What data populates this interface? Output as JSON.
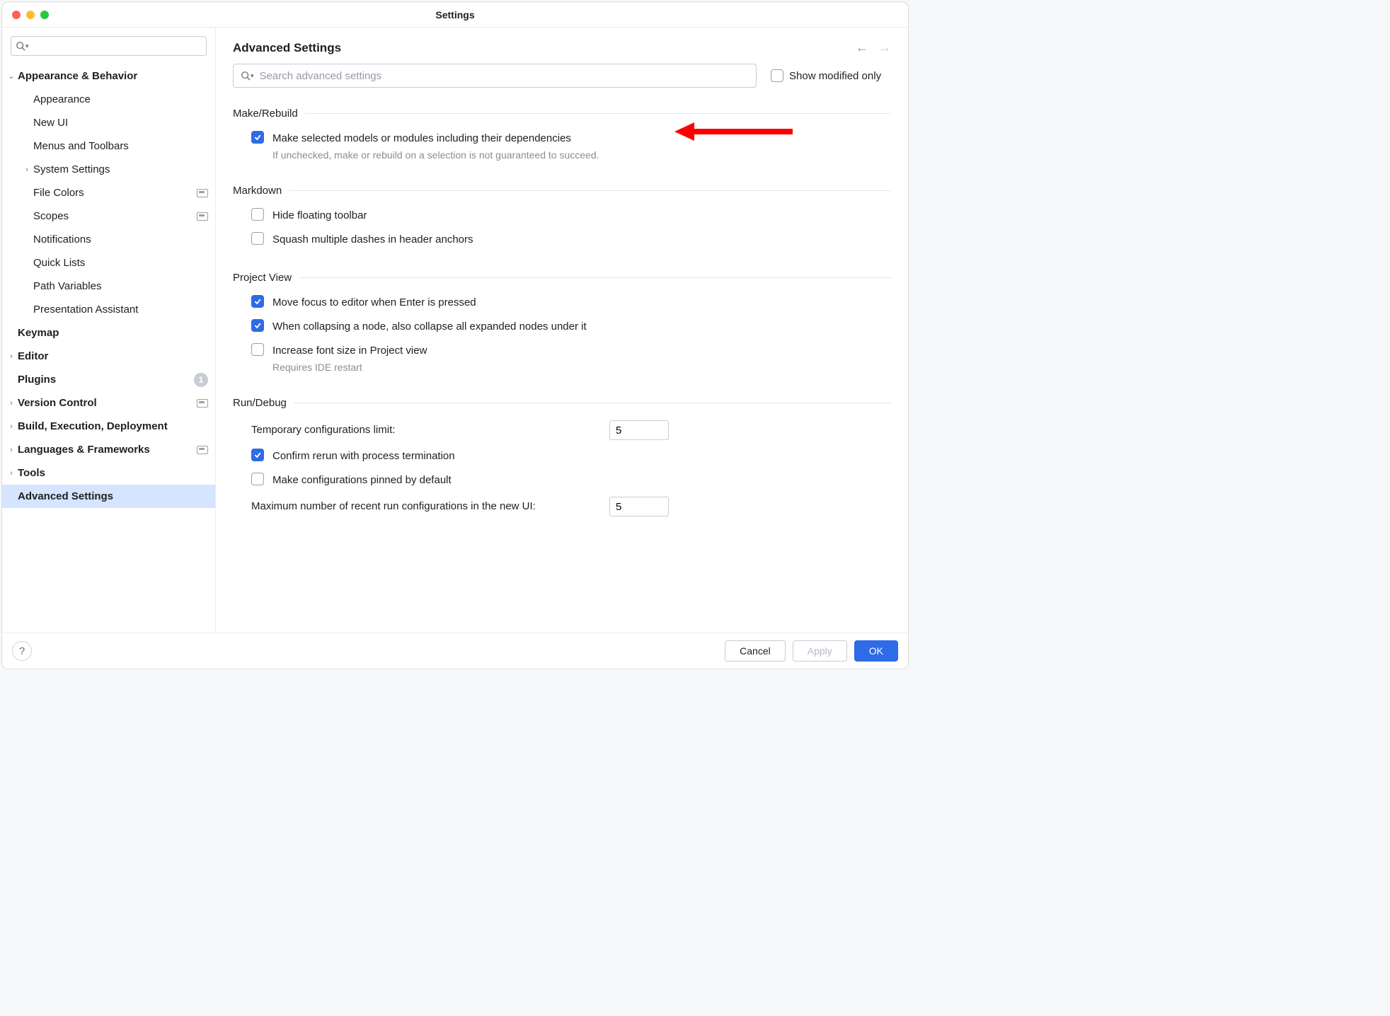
{
  "window": {
    "title": "Settings"
  },
  "sidebar": {
    "search_value": "",
    "items": [
      {
        "label": "Appearance & Behavior",
        "bold": true,
        "arrow": "down",
        "indent": 1
      },
      {
        "label": "Appearance",
        "indent": 2
      },
      {
        "label": "New UI",
        "indent": 2
      },
      {
        "label": "Menus and Toolbars",
        "indent": 2
      },
      {
        "label": "System Settings",
        "indent": 2,
        "arrow": "right"
      },
      {
        "label": "File Colors",
        "indent": 2,
        "tag": true
      },
      {
        "label": "Scopes",
        "indent": 2,
        "tag": true
      },
      {
        "label": "Notifications",
        "indent": 2
      },
      {
        "label": "Quick Lists",
        "indent": 2
      },
      {
        "label": "Path Variables",
        "indent": 2
      },
      {
        "label": "Presentation Assistant",
        "indent": 2
      },
      {
        "label": "Keymap",
        "bold": true,
        "indent": 1
      },
      {
        "label": "Editor",
        "bold": true,
        "arrow": "right",
        "indent": 1
      },
      {
        "label": "Plugins",
        "bold": true,
        "indent": 1,
        "count": "1"
      },
      {
        "label": "Version Control",
        "bold": true,
        "arrow": "right",
        "indent": 1,
        "tag": true
      },
      {
        "label": "Build, Execution, Deployment",
        "bold": true,
        "arrow": "right",
        "indent": 1
      },
      {
        "label": "Languages & Frameworks",
        "bold": true,
        "arrow": "right",
        "indent": 1,
        "tag": true
      },
      {
        "label": "Tools",
        "bold": true,
        "arrow": "right",
        "indent": 1
      },
      {
        "label": "Advanced Settings",
        "bold": true,
        "indent": 1,
        "selected": true
      }
    ]
  },
  "main": {
    "title": "Advanced Settings",
    "search_placeholder": "Search advanced settings",
    "show_modified_only": {
      "label": "Show modified only",
      "checked": false
    },
    "sections": {
      "make_rebuild": {
        "title": "Make/Rebuild",
        "opt1": {
          "label": "Make selected models or modules including their dependencies",
          "desc": "If unchecked, make or rebuild on a selection is not guaranteed to succeed.",
          "checked": true
        }
      },
      "markdown": {
        "title": "Markdown",
        "opt1": {
          "label": "Hide floating toolbar",
          "checked": false
        },
        "opt2": {
          "label": "Squash multiple dashes in header anchors",
          "checked": false
        }
      },
      "project_view": {
        "title": "Project View",
        "opt1": {
          "label": "Move focus to editor when Enter is pressed",
          "checked": true
        },
        "opt2": {
          "label": "When collapsing a node, also collapse all expanded nodes under it",
          "checked": true
        },
        "opt3": {
          "label": "Increase font size in Project view",
          "desc": "Requires IDE restart",
          "checked": false
        }
      },
      "run_debug": {
        "title": "Run/Debug",
        "temp_limit_label": "Temporary configurations limit:",
        "temp_limit_value": "5",
        "opt1": {
          "label": "Confirm rerun with process termination",
          "checked": true
        },
        "opt2": {
          "label": "Make configurations pinned by default",
          "checked": false
        },
        "max_recent_label": "Maximum number of recent run configurations in the new UI:",
        "max_recent_value": "5"
      }
    }
  },
  "footer": {
    "cancel": "Cancel",
    "apply": "Apply",
    "ok": "OK"
  }
}
